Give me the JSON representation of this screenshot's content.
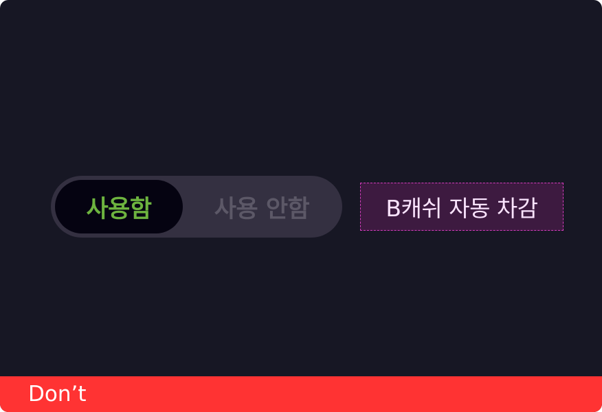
{
  "toggle": {
    "on_label": "사용함",
    "off_label": "사용 안함",
    "selected": "on_label"
  },
  "annotation": {
    "label": "B캐쉬 자동 차감"
  },
  "footer": {
    "label": "Don’t"
  },
  "colors": {
    "background": "#171724",
    "toggle_track": "#343041",
    "toggle_knob": "#050311",
    "on_text": "#6db33f",
    "off_text": "#5c5867",
    "annotation_border": "#d83cc0",
    "annotation_fill": "#3d1a40",
    "annotation_text": "#fbe4ff",
    "footer_bg": "#ff3333",
    "footer_text": "#ffffff"
  }
}
